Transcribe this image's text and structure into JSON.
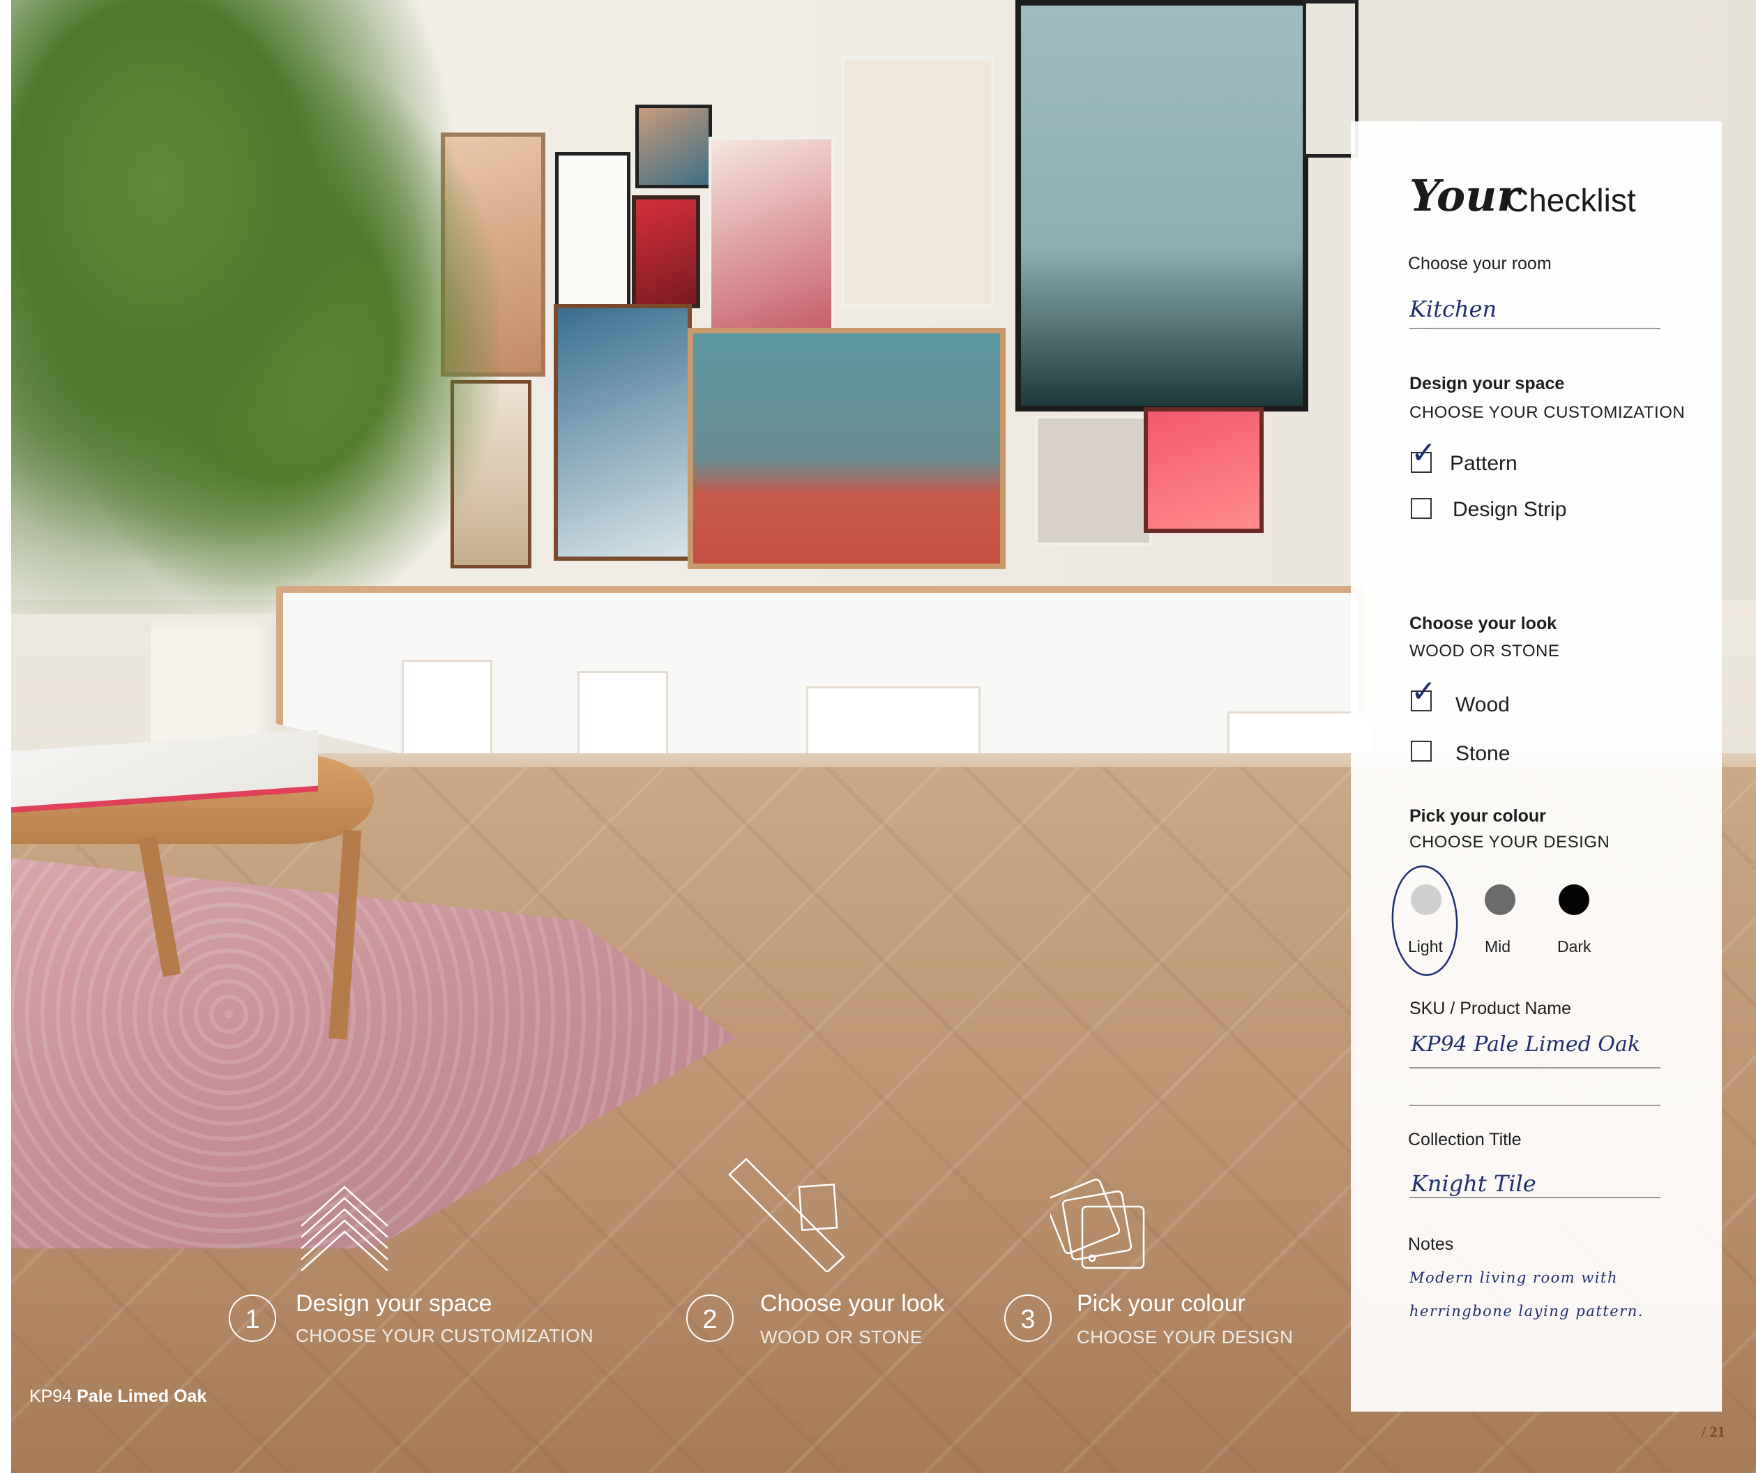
{
  "caption": {
    "code": "KP94",
    "name": "Pale Limed Oak"
  },
  "page_number": "/ 21",
  "steps": [
    {
      "number": "1",
      "title": "Design your space",
      "subtitle": "CHOOSE YOUR CUSTOMIZATION",
      "icon": "herringbone-chevron-icon"
    },
    {
      "number": "2",
      "title": "Choose your look",
      "subtitle": "WOOD OR STONE",
      "icon": "plank-and-tile-icon"
    },
    {
      "number": "3",
      "title": "Pick your colour",
      "subtitle": "CHOOSE YOUR DESIGN",
      "icon": "colour-swatches-icon"
    }
  ],
  "checklist": {
    "title_script": "Your",
    "title": "Checklist",
    "room": {
      "label": "Choose your room",
      "value": "Kitchen"
    },
    "space": {
      "heading": "Design your space",
      "subheading": "CHOOSE YOUR CUSTOMIZATION",
      "options": [
        {
          "label": "Pattern",
          "checked": true
        },
        {
          "label": "Design Strip",
          "checked": false
        }
      ]
    },
    "look": {
      "heading": "Choose your look",
      "subheading": "WOOD OR STONE",
      "options": [
        {
          "label": "Wood",
          "checked": true
        },
        {
          "label": "Stone",
          "checked": false
        }
      ]
    },
    "colour": {
      "heading": "Pick your colour",
      "subheading": "CHOOSE YOUR DESIGN",
      "options": [
        {
          "label": "Light",
          "color": "#cfcfcf",
          "selected": true
        },
        {
          "label": "Mid",
          "color": "#6b6b6b",
          "selected": false
        },
        {
          "label": "Dark",
          "color": "#050505",
          "selected": false
        }
      ]
    },
    "sku": {
      "label": "SKU / Product Name",
      "value": "KP94 Pale Limed Oak"
    },
    "collection": {
      "label": "Collection Title",
      "value": "Knight Tile"
    },
    "notes": {
      "label": "Notes",
      "line1": "Modern living room with",
      "line2": "herringbone laying pattern."
    }
  },
  "colors": {
    "ink": "#1f2f6a",
    "text": "#1e1e1e",
    "accent_brown": "#7a4a2c"
  }
}
